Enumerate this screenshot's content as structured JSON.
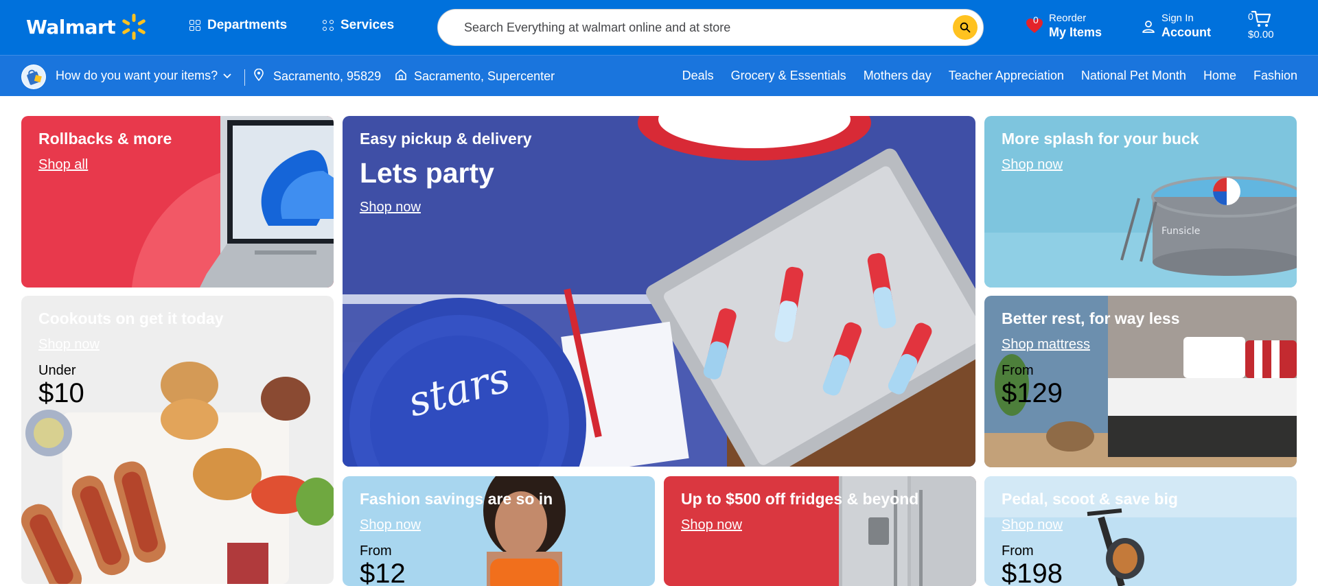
{
  "brand": {
    "name": "Walmart",
    "accent": "#ffc220",
    "primary": "#0071dc"
  },
  "header": {
    "departments_label": "Departments",
    "services_label": "Services",
    "search_placeholder": "Search Everything at walmart online and at store",
    "reorder": {
      "count": "0",
      "small": "Reorder",
      "bold": "My Items"
    },
    "account": {
      "small": "Sign In",
      "bold": "Account"
    },
    "cart": {
      "count": "0",
      "total": "$0.00"
    }
  },
  "subbar": {
    "fulfillment_prompt": "How do you want your items?",
    "location": "Sacramento, 95829",
    "store": "Sacramento, Supercenter",
    "nav": [
      "Deals",
      "Grocery & Essentials",
      "Mothers day",
      "Teacher Appreciation",
      "National Pet Month",
      "Home",
      "Fashion"
    ]
  },
  "tiles": {
    "rollbacks": {
      "title": "Rollbacks & more",
      "link": "Shop all"
    },
    "party": {
      "kicker": "Easy pickup & delivery",
      "title": "Lets party",
      "link": "Shop now",
      "plate_text": "stars and stripes"
    },
    "splash": {
      "title": "More splash for your buck",
      "link": "Shop now",
      "pool_brand": "Funsicle"
    },
    "cookouts": {
      "title": "Cookouts on get it today",
      "link": "Shop now",
      "from": "Under",
      "price": "$10"
    },
    "rest": {
      "title": "Better rest, for way less",
      "link": "Shop mattress",
      "from": "From",
      "price": "$129"
    },
    "fashion": {
      "title": "Fashion savings are so in",
      "link": "Shop now",
      "from": "From",
      "price": "$12"
    },
    "fridges": {
      "title": "Up to $500 off fridges & beyond",
      "link": "Shop now"
    },
    "pedal": {
      "title": "Pedal, scoot & save big",
      "link": "Shop now",
      "from": "From",
      "price": "$198"
    }
  },
  "icons": [
    "departments-grid-icon",
    "services-icon",
    "search-icon",
    "heart-icon",
    "person-icon",
    "cart-icon",
    "location-pin-icon",
    "store-icon",
    "chevron-down-icon"
  ]
}
